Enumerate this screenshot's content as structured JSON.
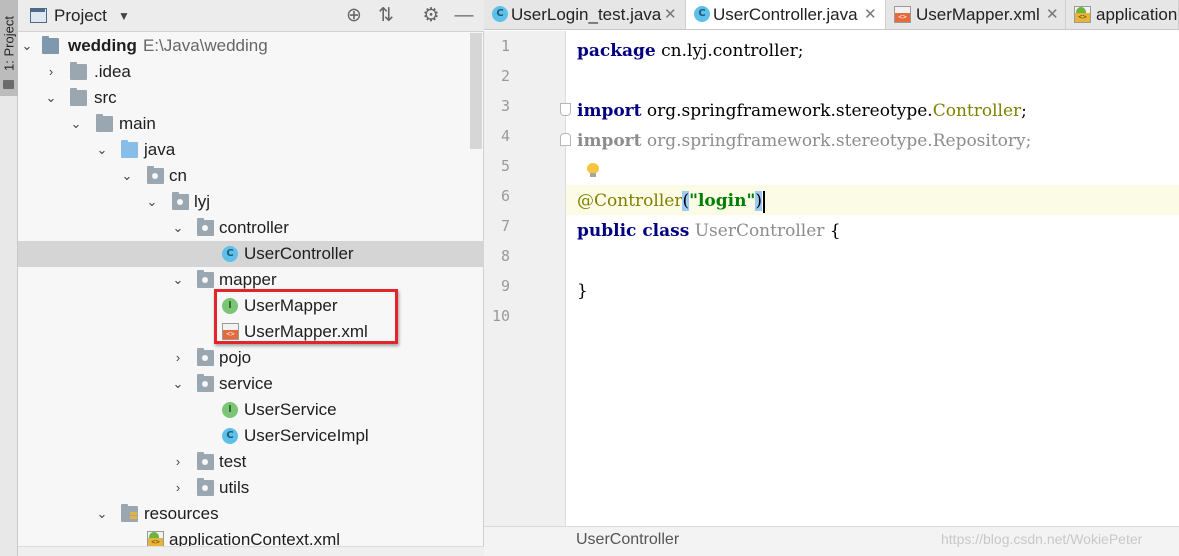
{
  "sidebar_strip": {
    "label": "1: Project"
  },
  "project_panel": {
    "title": "Project",
    "header_icons": [
      "crosshair-icon",
      "collapse-icon",
      "gear-icon",
      "minimize-icon"
    ]
  },
  "tree": [
    {
      "label": "wedding",
      "path": "E:\\Java\\wedding",
      "icon": "project-folder-icon",
      "expanded": true
    },
    {
      "label": ".idea",
      "icon": "folder-icon",
      "expanded": false
    },
    {
      "label": "src",
      "icon": "folder-icon",
      "expanded": true
    },
    {
      "label": "main",
      "icon": "folder-icon",
      "expanded": true
    },
    {
      "label": "java",
      "icon": "source-folder-icon",
      "expanded": true
    },
    {
      "label": "cn",
      "icon": "package-icon",
      "expanded": true
    },
    {
      "label": "lyj",
      "icon": "package-icon",
      "expanded": true
    },
    {
      "label": "controller",
      "icon": "package-icon",
      "expanded": true
    },
    {
      "label": "UserController",
      "icon": "class-icon",
      "selected": true
    },
    {
      "label": "mapper",
      "icon": "package-icon",
      "expanded": true
    },
    {
      "label": "UserMapper",
      "icon": "interface-icon",
      "highlighted": true
    },
    {
      "label": "UserMapper.xml",
      "icon": "xml-file-icon",
      "highlighted": true
    },
    {
      "label": "pojo",
      "icon": "package-icon",
      "expanded": false
    },
    {
      "label": "service",
      "icon": "package-icon",
      "expanded": true
    },
    {
      "label": "UserService",
      "icon": "interface-icon"
    },
    {
      "label": "UserServiceImpl",
      "icon": "class-icon"
    },
    {
      "label": "test",
      "icon": "package-icon",
      "expanded": false
    },
    {
      "label": "utils",
      "icon": "package-icon",
      "expanded": false
    },
    {
      "label": "resources",
      "icon": "resources-folder-icon",
      "expanded": true
    },
    {
      "label": "applicationContext.xml",
      "icon": "spring-xml-icon"
    }
  ],
  "tabs": [
    {
      "label": "UserLogin_test.java",
      "icon": "test-class-icon",
      "active": false
    },
    {
      "label": "UserController.java",
      "icon": "class-icon",
      "active": true
    },
    {
      "label": "UserMapper.xml",
      "icon": "xml-file-icon",
      "active": false
    },
    {
      "label": "application",
      "icon": "spring-xml-icon",
      "active": false
    }
  ],
  "editor": {
    "line_numbers": [
      "1",
      "2",
      "3",
      "4",
      "5",
      "6",
      "7",
      "8",
      "9",
      "10"
    ],
    "code": {
      "l1_kw": "package",
      "l1_rest": " cn.lyj.controller;",
      "l3_kw": "import",
      "l3_pkg": " org.springframework.stereotype.",
      "l3_cls": "Controller",
      "l3_end": ";",
      "l4_kw": "import",
      "l4_rest": " org.springframework.stereotype.Repository;",
      "l6_anno": "@Controller",
      "l6_open": "(",
      "l6_str": "\"login\"",
      "l6_close": ")",
      "l7_kw": "public class",
      "l7_name": " UserController",
      "l7_brace": " {",
      "l9_brace": "}"
    },
    "current_line": "6"
  },
  "breadcrumb": "UserController",
  "watermark": "https://blog.csdn.net/WokiePeter",
  "colors": {
    "selection": "#d5d5d5",
    "highlight_box": "#e1262b",
    "keyword": "#000080",
    "annotation": "#808000",
    "string": "#008000",
    "caret_line": "#fcfbe6"
  }
}
